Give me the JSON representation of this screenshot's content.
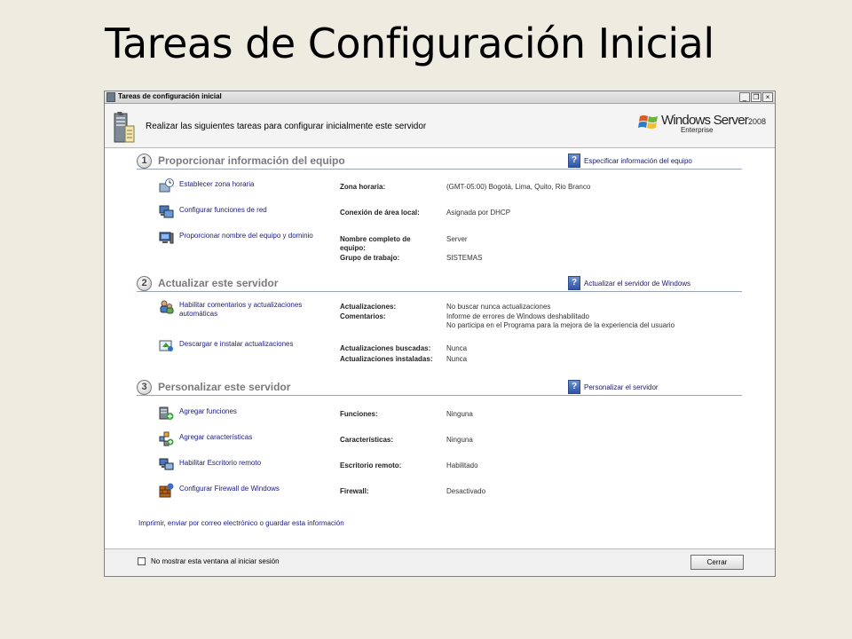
{
  "slide": {
    "title": "Tareas de Configuración Inicial"
  },
  "window": {
    "title": "Tareas de configuración inicial",
    "controls": [
      "_",
      "❐",
      "×"
    ]
  },
  "banner": {
    "text": "Realizar las siguientes tareas para configurar inicialmente este servidor",
    "brand_name": "Windows Server",
    "brand_year": "2008",
    "brand_edition": "Enterprise"
  },
  "sections": [
    {
      "number": "1",
      "title": "Proporcionar información del equipo",
      "help": "Especificar información del equipo",
      "tasks": [
        {
          "label": "Establecer zona horaria",
          "icon": "clock-icon"
        },
        {
          "label": "Configurar funciones de red",
          "icon": "network-icon"
        },
        {
          "label": "Proporcionar nombre del equipo y dominio",
          "icon": "computer-icon"
        }
      ],
      "props": [
        {
          "label": "Zona horaria:",
          "value": "(GMT-05:00) Bogotá, Lima, Quito, Rio Branco"
        },
        {
          "label": "Conexión de área local:",
          "value": "Asignada por DHCP"
        },
        {
          "label": "Nombre completo de equipo:",
          "value": "Server"
        },
        {
          "label": "Grupo de trabajo:",
          "value": "SISTEMAS"
        }
      ]
    },
    {
      "number": "2",
      "title": "Actualizar este servidor",
      "help": "Actualizar el servidor de Windows",
      "tasks": [
        {
          "label": "Habilitar comentarios y actualizaciones automáticas",
          "icon": "users-icon"
        },
        {
          "label": "Descargar e instalar actualizaciones",
          "icon": "update-icon"
        }
      ],
      "props": [
        {
          "label": "Actualizaciones:",
          "value": "No buscar nunca actualizaciones"
        },
        {
          "label": "Comentarios:",
          "value": "Informe de errores de Windows deshabilitado"
        },
        {
          "label": "",
          "value": "No participa en el Programa para la mejora de la experiencia del usuario"
        },
        {
          "label": "Actualizaciones buscadas:",
          "value": "Nunca"
        },
        {
          "label": "Actualizaciones instaladas:",
          "value": "Nunca"
        }
      ]
    },
    {
      "number": "3",
      "title": "Personalizar este servidor",
      "help": "Personalizar el servidor",
      "tasks": [
        {
          "label": "Agregar funciones",
          "icon": "add-roles-icon"
        },
        {
          "label": "Agregar características",
          "icon": "add-features-icon"
        },
        {
          "label": "Habilitar Escritorio remoto",
          "icon": "remote-desktop-icon"
        },
        {
          "label": "Configurar Firewall de Windows",
          "icon": "firewall-icon"
        }
      ],
      "props": [
        {
          "label": "Funciones:",
          "value": "Ninguna"
        },
        {
          "label": "Características:",
          "value": "Ninguna"
        },
        {
          "label": "Escritorio remoto:",
          "value": "Habilitado"
        },
        {
          "label": "Firewall:",
          "value": "Desactivado"
        }
      ]
    }
  ],
  "print_link": "Imprimir, enviar por correo electrónico o guardar esta información",
  "footer": {
    "checkbox_label": "No mostrar esta ventana al iniciar sesión",
    "close_label": "Cerrar"
  }
}
